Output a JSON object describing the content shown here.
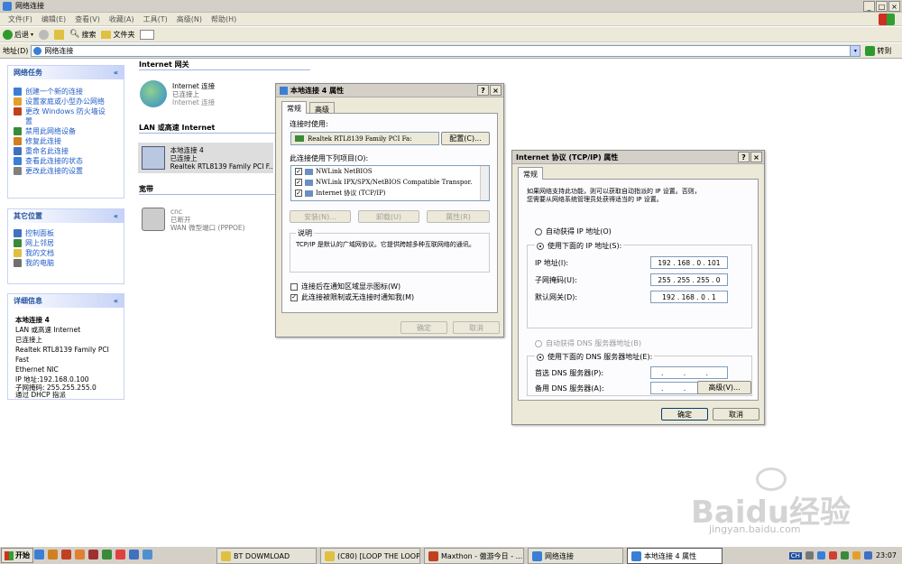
{
  "window": {
    "title": "网络连接",
    "close_glyph": "×",
    "min_glyph": "_",
    "max_glyph": "□"
  },
  "menu": [
    {
      "label": "文件(F)"
    },
    {
      "label": "编辑(E)"
    },
    {
      "label": "查看(V)"
    },
    {
      "label": "收藏(A)"
    },
    {
      "label": "工具(T)"
    },
    {
      "label": "高级(N)"
    },
    {
      "label": "帮助(H)"
    }
  ],
  "toolbar": {
    "back": "后退",
    "search": "搜索",
    "folders": "文件夹"
  },
  "address": {
    "label": "地址(D)",
    "value": "网络连接",
    "go": "转到"
  },
  "sidebar": {
    "tasks": {
      "title": "网络任务",
      "items": [
        {
          "label": "创建一个新的连接",
          "color": "#3a7fd5"
        },
        {
          "label": "设置家庭或小型办公网络",
          "color": "#e0a030"
        },
        {
          "label": "更改 Windows 防火墙设",
          "color": "#c04020"
        },
        {
          "label": "置",
          "color": "#ffffff"
        },
        {
          "label": "禁用此网络设备",
          "color": "#3a8a3a"
        },
        {
          "label": "修复此连接",
          "color": "#d08020"
        },
        {
          "label": "重命名此连接",
          "color": "#4070c0"
        },
        {
          "label": "查看此连接的状态",
          "color": "#3a7fd5"
        },
        {
          "label": "更改此连接的设置",
          "color": "#808080"
        }
      ]
    },
    "places": {
      "title": "其它位置",
      "items": [
        {
          "label": "控制面板",
          "color": "#4070c0"
        },
        {
          "label": "网上邻居",
          "color": "#3a8a3a"
        },
        {
          "label": "我的文档",
          "color": "#e0c040"
        },
        {
          "label": "我的电脑",
          "color": "#707070"
        }
      ]
    },
    "details": {
      "title": "详细信息",
      "name": "本地连接 4",
      "type": "LAN 或高速 Internet",
      "status": "已连接上",
      "adapter1": "Realtek RTL8139 Family PCI Fast",
      "adapter2": "Ethernet NIC",
      "ip": "IP 地址:192.168.0.100",
      "mask": "子网掩码: 255.255.255.0",
      "dhcp": "通过 DHCP 指派"
    }
  },
  "sections": {
    "internet": {
      "title": "Internet 网关",
      "name": "Internet 连接",
      "status": "已连接上",
      "sub": "Internet 连接"
    },
    "lan": {
      "title": "LAN 或高速 Internet",
      "name": "本地连接 4",
      "status": "已连接上",
      "sub": "Realtek RTL8139 Family PCI F..."
    },
    "broadband": {
      "title": "宽带",
      "name": "cnc",
      "status": "已断开",
      "sub": "WAN 微型端口 (PPPOE)"
    }
  },
  "props_dialog": {
    "title": "本地连接 4 属性",
    "tabs": [
      "常规",
      "高级"
    ],
    "connect_using": "连接时使用:",
    "adapter": "Realtek RTL8139 Family PCI Fa:",
    "configure": "配置(C)...",
    "items_label": "此连接使用下列项目(O):",
    "items": [
      "NWLink NetBIOS",
      "NWLink IPX/SPX/NetBIOS Compatible Transpor.",
      "Internet 协议 (TCP/IP)"
    ],
    "install": "安装(N)...",
    "uninstall": "卸载(U)",
    "properties": "属性(R)",
    "desc_title": "说明",
    "desc_text": "TCP/IP 是默认的广域网协议。它提供跨越多种互联网络的通讯。",
    "chk_notify_icon": "连接后在通知区域显示图标(W)",
    "chk_notify_limit": "此连接被限制或无连接时通知我(M)",
    "ok": "确定",
    "cancel": "取消"
  },
  "tcpip_dialog": {
    "title": "Internet 协议 (TCP/IP) 属性",
    "tab": "常规",
    "intro1": "如果网络支持此功能，则可以获取自动指派的 IP 设置。否则，",
    "intro2": "您需要从网络系统管理员处获得适当的 IP 设置。",
    "auto_ip": "自动获得 IP 地址(O)",
    "manual_ip": "使用下面的 IP 地址(S):",
    "ip_label": "IP 地址(I):",
    "ip_value": "192 . 168 . 0 . 101",
    "mask_label": "子网掩码(U):",
    "mask_value": "255 . 255 . 255 . 0",
    "gw_label": "默认网关(D):",
    "gw_value": "192 . 168 . 0 . 1",
    "auto_dns": "自动获得 DNS 服务器地址(B)",
    "manual_dns": "使用下面的 DNS 服务器地址(E):",
    "dns1_label": "首选 DNS 服务器(P):",
    "dns1_value": ". . .",
    "dns2_label": "备用 DNS 服务器(A):",
    "dns2_value": ". . .",
    "advanced": "高级(V)...",
    "ok": "确定",
    "cancel": "取消"
  },
  "taskbar": {
    "start": "开始",
    "tasks": [
      {
        "label": "BT DOWMLOAD",
        "color": "#e0c040"
      },
      {
        "label": "(C80) [LOOP THE LOOP!",
        "color": "#e0c040"
      },
      {
        "label": "Maxthon - 傲游今日 - ...",
        "color": "#c04020"
      },
      {
        "label": "网络连接",
        "color": "#3a7fd5"
      },
      {
        "label": "本地连接 4 属性",
        "color": "#3a7fd5"
      }
    ],
    "lang": "CH",
    "clock": "23:07"
  },
  "watermark": {
    "text": "Baidu经验",
    "url": "jingyan.baidu.com"
  }
}
